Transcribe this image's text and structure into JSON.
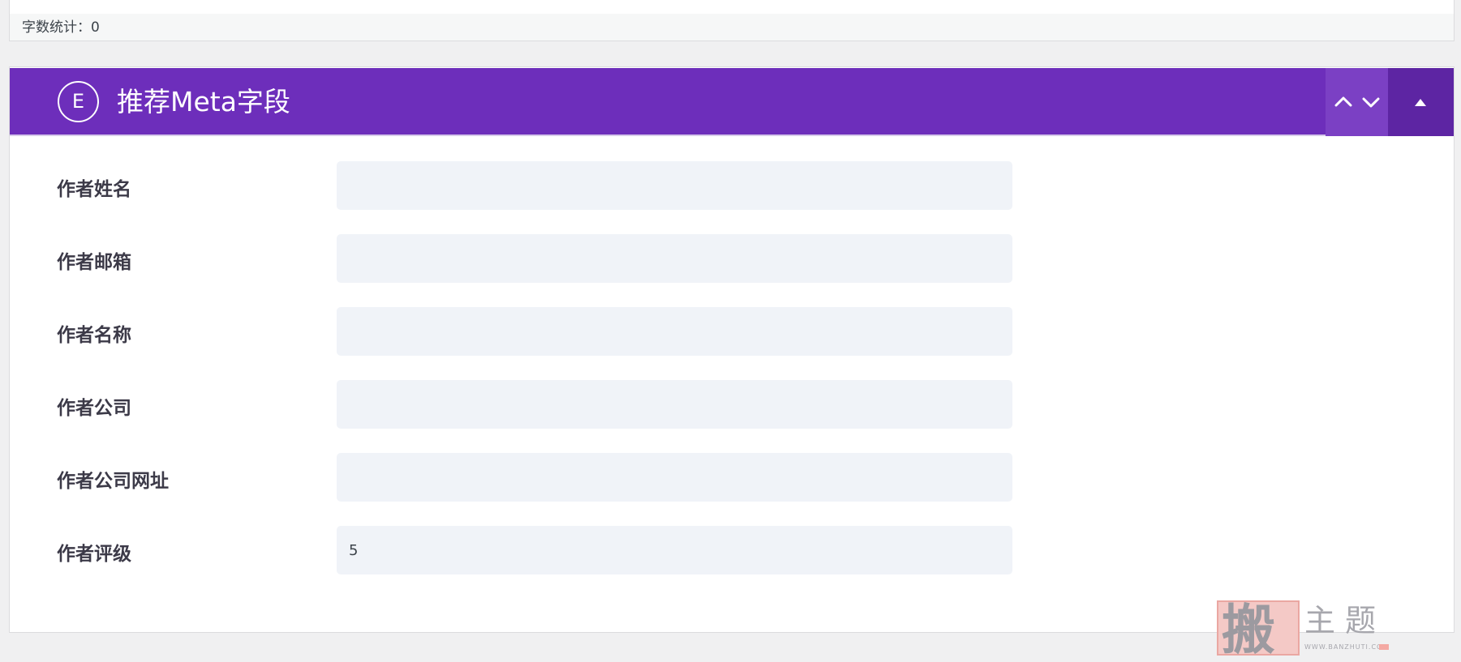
{
  "editor": {
    "word_count_label": "字数统计：0"
  },
  "metabox": {
    "logo_letter": "E",
    "title": "推荐Meta字段",
    "colors": {
      "header_bg": "#6d2ebb",
      "order_bg": "#7b40c4",
      "toggle_bg": "#5d25a3",
      "input_bg": "#f0f3f8"
    },
    "fields": [
      {
        "label": "作者姓名",
        "value": ""
      },
      {
        "label": "作者邮箱",
        "value": ""
      },
      {
        "label": "作者名称",
        "value": ""
      },
      {
        "label": "作者公司",
        "value": ""
      },
      {
        "label": "作者公司网址",
        "value": ""
      },
      {
        "label": "作者评级",
        "value": "5"
      }
    ]
  },
  "watermark": {
    "seal_char": "搬",
    "text": "主题",
    "url": "WWW.BANZHUTI.COM"
  }
}
